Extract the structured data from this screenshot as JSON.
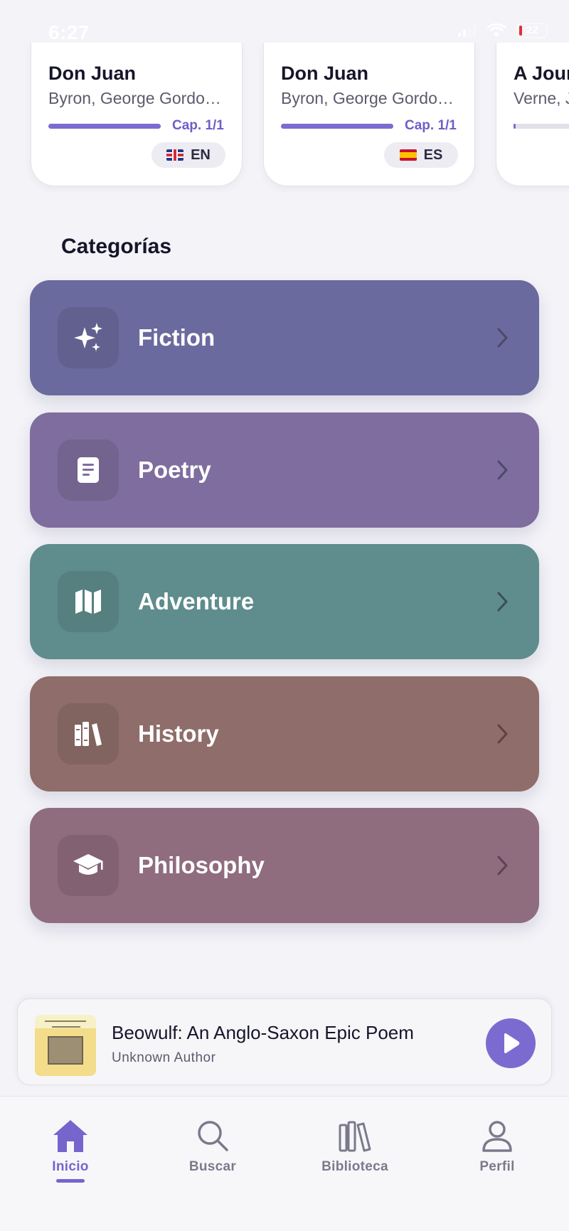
{
  "status_bar": {
    "time": "6:27",
    "battery": "22"
  },
  "recent_books": [
    {
      "title": "Don Juan",
      "author": "Byron, George Gordon Byron, Baron",
      "chapter": "Cap. 1/1",
      "progress": 1.0,
      "flag": "uk-flag",
      "language": "EN"
    },
    {
      "title": "Don Juan",
      "author": "Byron, George Gordon Byron, Baron",
      "chapter": "Cap. 1/1",
      "progress": 1.0,
      "flag": "es-flag",
      "language": "ES"
    },
    {
      "title": "A Journey",
      "author": "Verne, Jules",
      "progress": 0.02
    }
  ],
  "categories_section": {
    "title": "Categorías",
    "items": [
      {
        "label": "Fiction",
        "icon": "sparkles-icon",
        "color": "#6b6a9e"
      },
      {
        "label": "Poetry",
        "icon": "document-icon",
        "color": "#7e6d9e"
      },
      {
        "label": "Adventure",
        "icon": "map-icon",
        "color": "#5f8c8c"
      },
      {
        "label": "History",
        "icon": "books-icon",
        "color": "#8e6d6a"
      },
      {
        "label": "Philosophy",
        "icon": "graduation-cap-icon",
        "color": "#8f6c7e"
      }
    ]
  },
  "mini_player": {
    "title": "Beowulf: An Anglo-Saxon Epic Poem",
    "author": "Unknown Author",
    "play_icon": "play-icon"
  },
  "tab_bar": {
    "tabs": [
      {
        "label": "Inicio",
        "icon": "home-icon",
        "active": true
      },
      {
        "label": "Buscar",
        "icon": "search-icon",
        "active": false
      },
      {
        "label": "Biblioteca",
        "icon": "library-icon",
        "active": false
      },
      {
        "label": "Perfil",
        "icon": "profile-icon",
        "active": false
      }
    ]
  },
  "colors": {
    "accent": "#7565cc",
    "background": "#f3f3f8"
  }
}
